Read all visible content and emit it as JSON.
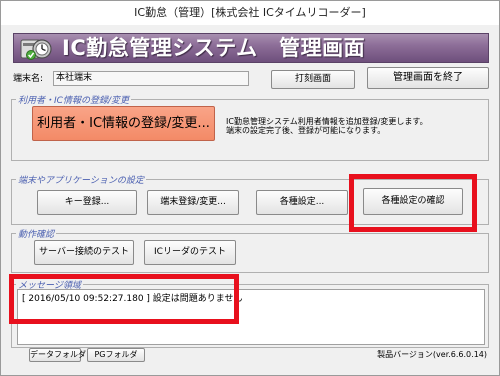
{
  "window": {
    "title": "IC勤怠（管理）[株式会社 ICタイムリコーダー]"
  },
  "banner": {
    "title": "IC勤怠管理システム　管理画面"
  },
  "terminal": {
    "label": "端末名:",
    "value": "本社端末"
  },
  "toolbar": {
    "print_label": "打刻画面",
    "exit_label": "管理画面を終了"
  },
  "group_user": {
    "legend": "利用者・IC情報の登録/変更",
    "register_label": "利用者・IC情報の登録/変更...",
    "description_line1": "IC勤怠管理システム利用者情報を追加登録/変更します。",
    "description_line2": "端末の設定完了後、登録が可能になります。"
  },
  "group_terminal": {
    "legend": "端末やアプリケーションの設定",
    "key_label": "キー登録...",
    "terminal_reg_label": "端末登録/変更...",
    "settings_label": "各種設定...",
    "confirm_label": "各種設定の確認"
  },
  "group_check": {
    "legend": "動作確認",
    "server_test_label": "サーバー接続のテスト",
    "ic_test_label": "ICリーダのテスト"
  },
  "group_message": {
    "legend": "メッセージ領域",
    "line1": "[ 2016/05/10 09:52:27.180 ] 設定は問題ありません"
  },
  "footer": {
    "data_folder_label": "データフォルダ",
    "pg_folder_label": "PGフォルダ",
    "version": "製品バージョン(ver.6.6.0.14)"
  },
  "colors": {
    "banner": "#8d6e98",
    "register_button": "#f38a67",
    "highlight": "#e8101d",
    "legend": "#4a5fb0"
  },
  "icons": {
    "banner_logo": "gear-clock-icon"
  }
}
